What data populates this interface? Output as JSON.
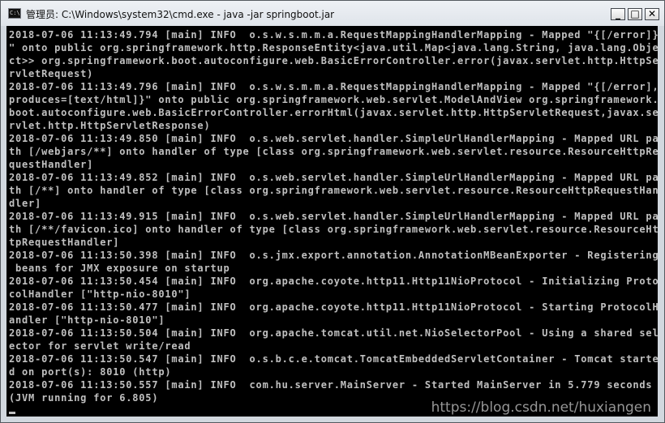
{
  "window": {
    "title": "管理员: C:\\Windows\\system32\\cmd.exe - java  -jar springboot.jar",
    "icon_text": "C:\\",
    "controls": {
      "minimize": "_",
      "maximize": "□",
      "close": "✕"
    }
  },
  "console": {
    "lines": [
      "2018-07-06 11:13:49.794 [main] INFO  o.s.w.s.m.m.a.RequestMappingHandlerMapping - Mapped \"{[/error]}",
      "\" onto public org.springframework.http.ResponseEntity<java.util.Map<java.lang.String, java.lang.Obje",
      "ct>> org.springframework.boot.autoconfigure.web.BasicErrorController.error(javax.servlet.http.HttpSe",
      "rvletRequest)",
      "2018-07-06 11:13:49.796 [main] INFO  o.s.w.s.m.m.a.RequestMappingHandlerMapping - Mapped \"{[/error],",
      "produces=[text/html]}\" onto public org.springframework.web.servlet.ModelAndView org.springframework.",
      "boot.autoconfigure.web.BasicErrorController.errorHtml(javax.servlet.http.HttpServletRequest,javax.se",
      "rvlet.http.HttpServletResponse)",
      "2018-07-06 11:13:49.850 [main] INFO  o.s.web.servlet.handler.SimpleUrlHandlerMapping - Mapped URL pa",
      "th [/webjars/**] onto handler of type [class org.springframework.web.servlet.resource.ResourceHttpRe",
      "questHandler]",
      "2018-07-06 11:13:49.852 [main] INFO  o.s.web.servlet.handler.SimpleUrlHandlerMapping - Mapped URL pa",
      "th [/**] onto handler of type [class org.springframework.web.servlet.resource.ResourceHttpRequestHan",
      "dler]",
      "2018-07-06 11:13:49.915 [main] INFO  o.s.web.servlet.handler.SimpleUrlHandlerMapping - Mapped URL pa",
      "th [/**/favicon.ico] onto handler of type [class org.springframework.web.servlet.resource.ResourceHt",
      "tpRequestHandler]",
      "2018-07-06 11:13:50.398 [main] INFO  o.s.jmx.export.annotation.AnnotationMBeanExporter - Registering",
      " beans for JMX exposure on startup",
      "2018-07-06 11:13:50.454 [main] INFO  org.apache.coyote.http11.Http11NioProtocol - Initializing Proto",
      "colHandler [\"http-nio-8010\"]",
      "2018-07-06 11:13:50.477 [main] INFO  org.apache.coyote.http11.Http11NioProtocol - Starting ProtocolH",
      "andler [\"http-nio-8010\"]",
      "2018-07-06 11:13:50.504 [main] INFO  org.apache.tomcat.util.net.NioSelectorPool - Using a shared sel",
      "ector for servlet write/read",
      "2018-07-06 11:13:50.547 [main] INFO  o.s.b.c.e.tomcat.TomcatEmbeddedServletContainer - Tomcat starte",
      "d on port(s): 8010 (http)",
      "2018-07-06 11:13:50.557 [main] INFO  com.hu.server.MainServer - Started MainServer in 5.779 seconds",
      "(JVM running for 6.805)"
    ]
  },
  "watermark": "https://blog.csdn.net/huxiangen",
  "colors": {
    "console_bg": "#000000",
    "console_text": "#c0c0c0",
    "titlebar": "#dfe4ea"
  }
}
